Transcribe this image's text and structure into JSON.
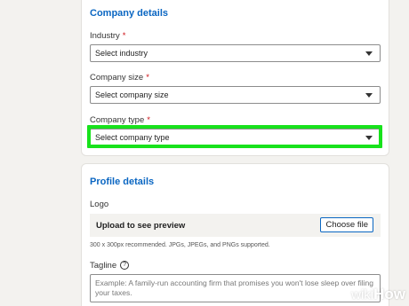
{
  "company_details": {
    "title": "Company details",
    "industry": {
      "label": "Industry",
      "required_mark": "*",
      "value": "Select industry"
    },
    "company_size": {
      "label": "Company size",
      "required_mark": "*",
      "value": "Select company size"
    },
    "company_type": {
      "label": "Company type",
      "required_mark": "*",
      "value": "Select company type"
    }
  },
  "profile_details": {
    "title": "Profile details",
    "logo": {
      "label": "Logo",
      "upload_text": "Upload to see preview",
      "button_label": "Choose file",
      "hint": "300 x 300px recommended. JPGs, JPEGs, and PNGs supported."
    },
    "tagline": {
      "label": "Tagline",
      "help_icon": "?",
      "placeholder": "Example: A family-run accounting firm that promises you won't lose sleep over filing your taxes."
    }
  },
  "watermark": {
    "wiki": "wiki",
    "how": "How"
  },
  "colors": {
    "accent": "#0a66c2",
    "highlight": "#18e21c",
    "required": "#cc1016"
  }
}
